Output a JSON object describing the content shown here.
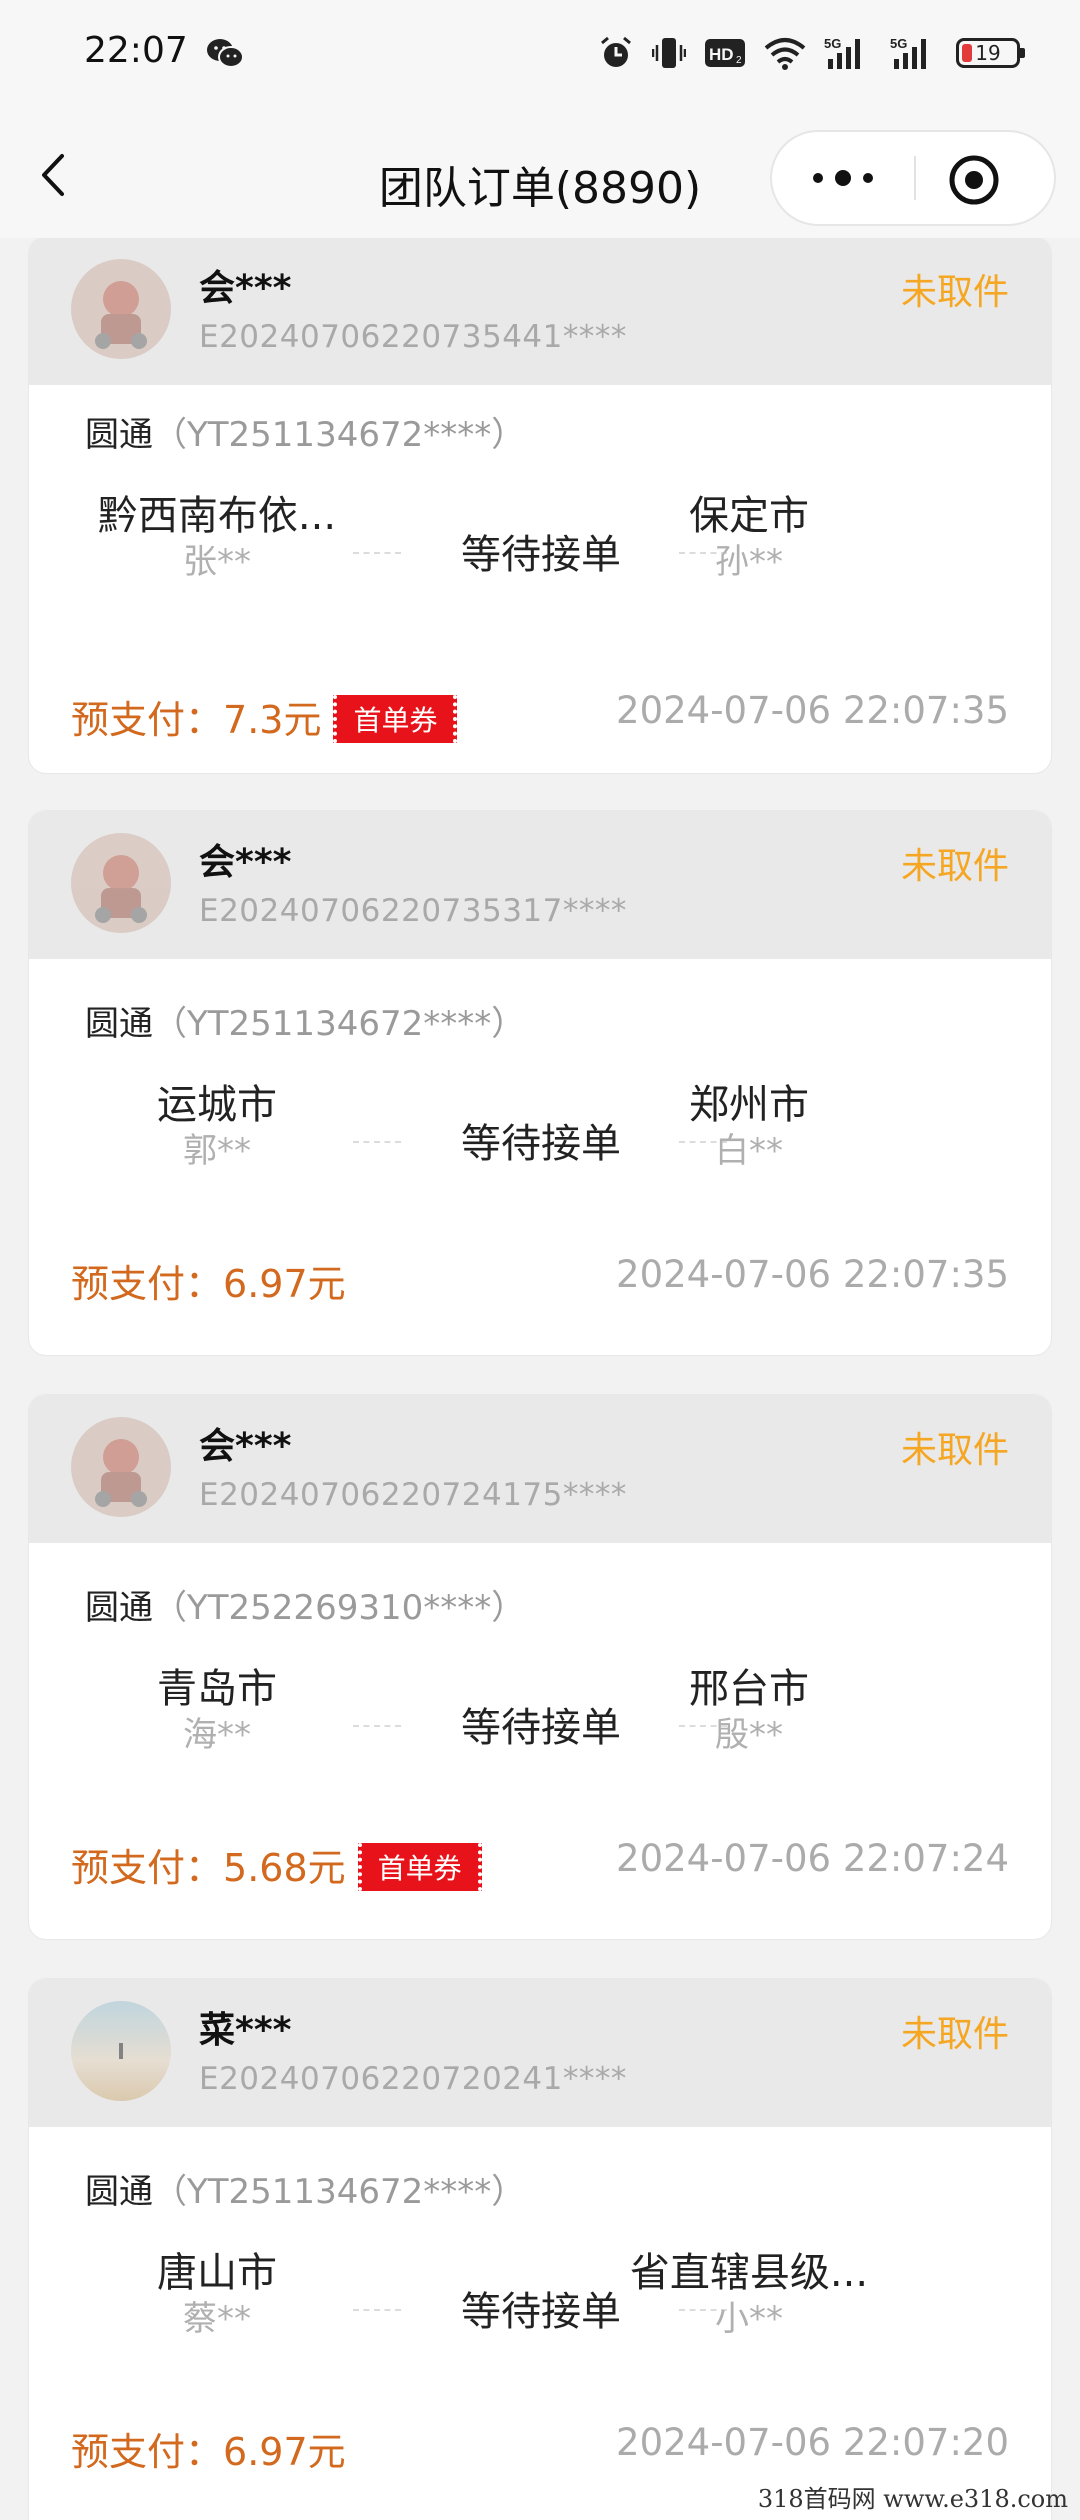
{
  "status_bar": {
    "time": "22:07",
    "battery": "19",
    "icons": [
      "wechat-icon",
      "alarm-icon",
      "vibrate-icon",
      "hd-icon",
      "wifi-icon",
      "signal-5g-icon",
      "signal-5g-icon",
      "battery-icon"
    ]
  },
  "nav": {
    "title": "团队订单(8890)",
    "icons": [
      "back-arrow-icon",
      "more-icon",
      "close-target-icon"
    ]
  },
  "orders": [
    {
      "user": "会***",
      "order_no": "E20240706220735441****",
      "status": "未取件",
      "courier": "圆通",
      "tracking": "（YT251134672****）",
      "from_city": "黔西南布依...",
      "from_person": "张**",
      "state": "等待接单",
      "to_city": "保定市",
      "to_person": "孙**",
      "pay_label": "预支付：",
      "pay_amount": "7.3元",
      "coupon": "首单券",
      "time": "2024-07-06 22:07:35"
    },
    {
      "user": "会***",
      "order_no": "E20240706220735317****",
      "status": "未取件",
      "courier": "圆通",
      "tracking": "（YT251134672****）",
      "from_city": "运城市",
      "from_person": "郭**",
      "state": "等待接单",
      "to_city": "郑州市",
      "to_person": "白**",
      "pay_label": "预支付：",
      "pay_amount": "6.97元",
      "coupon": "",
      "time": "2024-07-06 22:07:35"
    },
    {
      "user": "会***",
      "order_no": "E20240706220724175****",
      "status": "未取件",
      "courier": "圆通",
      "tracking": "（YT252269310****）",
      "from_city": "青岛市",
      "from_person": "海**",
      "state": "等待接单",
      "to_city": "邢台市",
      "to_person": "殷**",
      "pay_label": "预支付：",
      "pay_amount": "5.68元",
      "coupon": "首单券",
      "time": "2024-07-06 22:07:24"
    },
    {
      "user": "菜***",
      "order_no": "E20240706220720241****",
      "status": "未取件",
      "courier": "圆通",
      "tracking": "（YT251134672****）",
      "from_city": "唐山市",
      "from_person": "蔡**",
      "state": "等待接单",
      "to_city": "省直辖县级...",
      "to_person": "小**",
      "pay_label": "预支付：",
      "pay_amount": "6.97元",
      "coupon": "",
      "time": "2024-07-06 22:07:20"
    }
  ],
  "watermark": "318首码网 www.e318.com",
  "colors": {
    "status": "#f5a623",
    "pay": "#d2691e",
    "coupon": "#e8131a",
    "header_bg": "#e9e9e9"
  }
}
